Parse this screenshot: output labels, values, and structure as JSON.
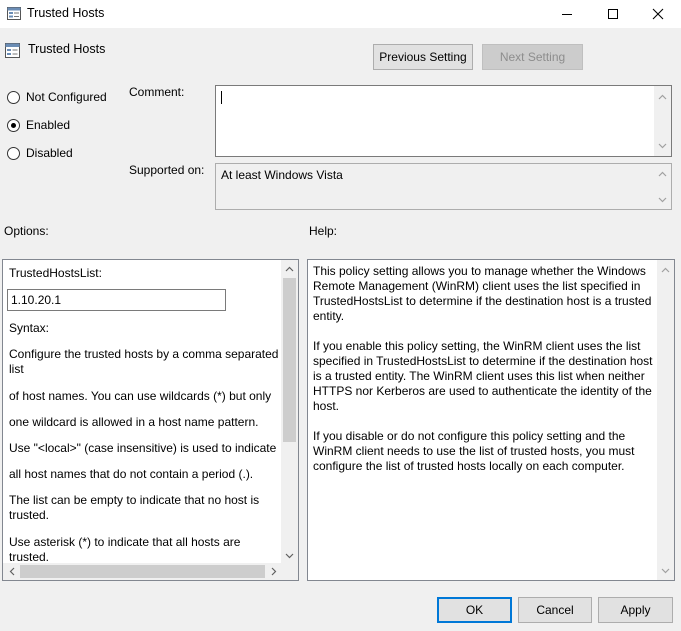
{
  "window": {
    "title": "Trusted Hosts",
    "header_title": "Trusted Hosts"
  },
  "nav": {
    "previous_label": "Previous Setting",
    "next_label": "Next Setting"
  },
  "state": {
    "options": [
      "Not Configured",
      "Enabled",
      "Disabled"
    ],
    "selected": "Enabled"
  },
  "comment": {
    "label": "Comment:",
    "value": ""
  },
  "supported": {
    "label": "Supported on:",
    "value": "At least Windows Vista"
  },
  "options_section": {
    "label": "Options:",
    "list_label": "TrustedHostsList:",
    "list_value": "1.10.20.1",
    "lines": [
      "Syntax:",
      "Configure the trusted hosts by a comma separated list",
      "of host names. You can use wildcards (*) but only",
      "one wildcard is allowed in a host name pattern.",
      "Use \"<local>\" (case insensitive) is used to indicate",
      "all host names that do not contain a period (.).",
      "The list can be empty to indicate that no host is trusted.",
      "Use asterisk (*)  to indicate that all hosts are trusted."
    ]
  },
  "help_section": {
    "label": "Help:",
    "paragraphs": [
      "This policy setting allows you to manage whether the Windows Remote Management (WinRM) client uses the list specified in TrustedHostsList to determine if the destination host is a trusted entity.",
      "If you enable this policy setting, the WinRM client uses the list specified in TrustedHostsList to determine if the destination host is a trusted entity. The WinRM client uses this list when neither HTTPS nor Kerberos are used to authenticate the identity of the host.",
      "If you disable or do not configure this policy setting and the WinRM client needs to use the list of trusted hosts, you must configure the list of trusted hosts locally on each computer."
    ]
  },
  "footer": {
    "ok_label": "OK",
    "cancel_label": "Cancel",
    "apply_label": "Apply"
  },
  "colors": {
    "accent": "#0078d7",
    "dialog_bg": "#f0f0f0"
  }
}
